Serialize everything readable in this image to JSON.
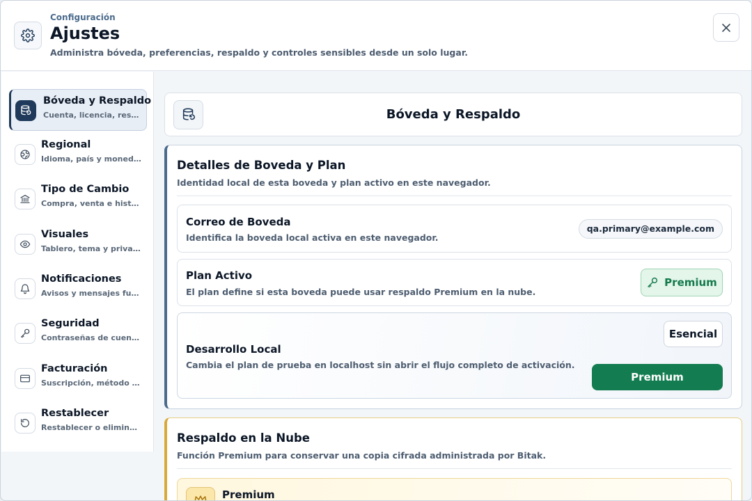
{
  "header": {
    "eyebrow": "Configuración",
    "title": "Ajustes",
    "subtitle": "Administra bóveda, preferencias, respaldo y controles sensibles desde un solo lugar."
  },
  "sidebar": {
    "items": [
      {
        "label": "Bóveda y Respaldo",
        "desc": "Cuenta, licencia, respaldo y nube",
        "icon": "database-backup-icon",
        "active": true
      },
      {
        "label": "Regional",
        "desc": "Idioma, país y moneda base",
        "icon": "globe-icon",
        "active": false
      },
      {
        "label": "Tipo de Cambio",
        "desc": "Compra, venta e historial",
        "icon": "bank-icon",
        "active": false
      },
      {
        "label": "Visuales",
        "desc": "Tablero, tema y privacidad",
        "icon": "eye-icon",
        "active": false
      },
      {
        "label": "Notificaciones",
        "desc": "Avisos y mensajes futuros",
        "icon": "bell-icon",
        "active": false
      },
      {
        "label": "Seguridad",
        "desc": "Contraseñas de cuenta y bóveda",
        "icon": "key-icon",
        "active": false
      },
      {
        "label": "Facturación",
        "desc": "Suscripción, método de pago",
        "icon": "credit-card-icon",
        "active": false
      },
      {
        "label": "Restablecer",
        "desc": "Restablecer o eliminar datos",
        "icon": "reset-icon",
        "active": false
      }
    ]
  },
  "main": {
    "section_title": "Bóveda y Respaldo",
    "vault_card": {
      "title": "Detalles de Boveda y Plan",
      "desc": "Identidad local de esta boveda y plan activo en este navegador.",
      "email_row": {
        "title": "Correo de Boveda",
        "desc": "Identifica la boveda local activa en este navegador.",
        "value": "qa.primary@example.com"
      },
      "plan_row": {
        "title": "Plan Activo",
        "desc": "El plan define si esta boveda puede usar respaldo Premium en la nube.",
        "badge": "Premium"
      },
      "dev_row": {
        "title": "Desarrollo Local",
        "desc": "Cambia el plan de prueba en localhost sin abrir el flujo completo de activación.",
        "btn_basic": "Esencial",
        "btn_premium": "Premium"
      }
    },
    "cloud_card": {
      "title": "Respaldo en la Nube",
      "desc": "Función Premium para conservar una copia cifrada administrada por Bitak.",
      "row_title": "Premium"
    }
  },
  "colors": {
    "accent_navy": "#1f3a5a",
    "premium_green": "#137d51",
    "premium_gold": "#d8a93a"
  }
}
